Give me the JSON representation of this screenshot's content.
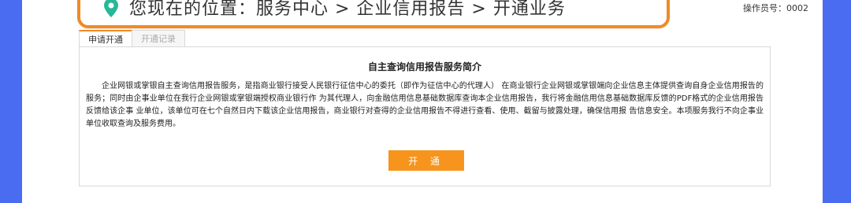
{
  "location": {
    "label": "您现在的位置：",
    "path": [
      "服务中心",
      "企业信用报告",
      "开通业务"
    ],
    "separator": ">",
    "text": "您现在的位置：服务中心 > 企业信用报告 > 开通业务"
  },
  "operator": "操作员号：0002",
  "tabs": [
    {
      "label": "申请开通"
    },
    {
      "label": "开通记录"
    }
  ],
  "intro": {
    "title": "自主查询信用报告服务简介",
    "body": "企业网银或掌银自主查询信用报告服务，是指商业银行接受人民银行征信中心的委托（即作为征信中心的代理人） 在商业银行企业网银或掌银端向企业信息主体提供查询自身企业信用报告的服务；同时由企事业单位在我行企业网银或掌银端授权商业银行作 为其代理人，向金融信用信息基础数据库查询本企业信用报告，我行将金融信用信息基础数据库反馈的PDF格式的企业信用报告反馈给该企事 业单位，该单位可在七个自然日内下载该企业信用报告，商业银行对查得的企业信用报告不得进行查看、使用、截留与披露处理，确保信用报 告信息安全。本项服务我行不向企事业单位收取查询及服务费用。"
  },
  "open_button": "开 通",
  "colors": {
    "accent": "#f08a24",
    "button": "#f7941d",
    "background": "#4a6cf0"
  }
}
